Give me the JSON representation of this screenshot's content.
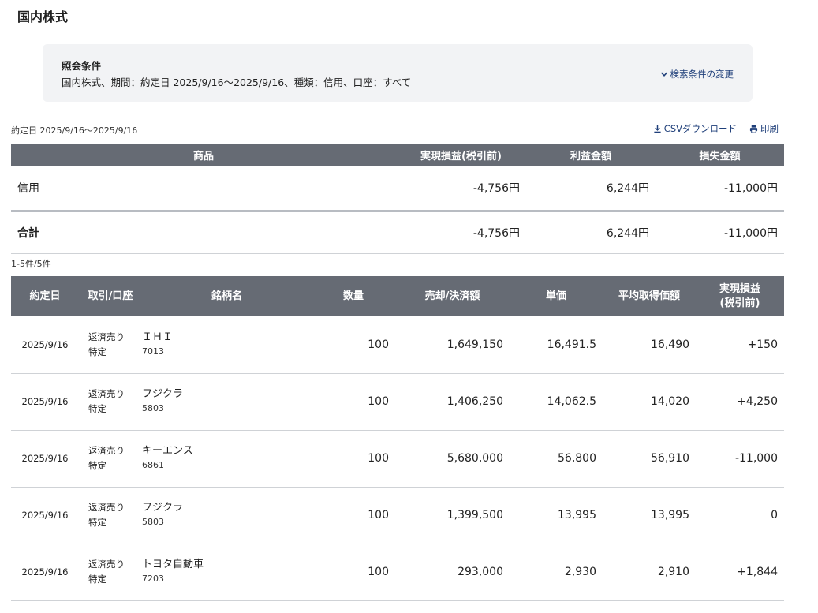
{
  "page_title": "国内株式",
  "conditions": {
    "label": "照会条件",
    "text": "国内株式、期間：約定日 2025/9/16〜2025/9/16、種類：信用、口座：すべて",
    "change_link": "検索条件の変更"
  },
  "range_label": "約定日 2025/9/16〜2025/9/16",
  "tools": {
    "csv": "CSVダウンロード",
    "print": "印刷"
  },
  "summary": {
    "headers": [
      "商品",
      "実現損益(税引前)",
      "利益金額",
      "損失金額"
    ],
    "row": {
      "product": "信用",
      "realized": "-4,756円",
      "profit": "6,244円",
      "loss": "-11,000円"
    },
    "total": {
      "label": "合計",
      "realized": "-4,756円",
      "profit": "6,244円",
      "loss": "-11,000円"
    }
  },
  "count_label": "1-5件/5件",
  "detail": {
    "headers": {
      "date": "約定日",
      "trade": "取引/口座",
      "stock": "銘柄名",
      "qty": "数量",
      "amount": "売却/決済額",
      "price": "単価",
      "avg": "平均取得価額",
      "pl_line1": "実現損益",
      "pl_line2": "(税引前)"
    },
    "rows": [
      {
        "date": "2025/9/16",
        "trade": "返済売り",
        "account": "特定",
        "name": "ＩＨＩ",
        "code": "7013",
        "qty": "100",
        "amount": "1,649,150",
        "price": "16,491.5",
        "avg": "16,490",
        "pl": "+150"
      },
      {
        "date": "2025/9/16",
        "trade": "返済売り",
        "account": "特定",
        "name": "フジクラ",
        "code": "5803",
        "qty": "100",
        "amount": "1,406,250",
        "price": "14,062.5",
        "avg": "14,020",
        "pl": "+4,250"
      },
      {
        "date": "2025/9/16",
        "trade": "返済売り",
        "account": "特定",
        "name": "キーエンス",
        "code": "6861",
        "qty": "100",
        "amount": "5,680,000",
        "price": "56,800",
        "avg": "56,910",
        "pl": "-11,000"
      },
      {
        "date": "2025/9/16",
        "trade": "返済売り",
        "account": "特定",
        "name": "フジクラ",
        "code": "5803",
        "qty": "100",
        "amount": "1,399,500",
        "price": "13,995",
        "avg": "13,995",
        "pl": "0"
      },
      {
        "date": "2025/9/16",
        "trade": "返済売り",
        "account": "特定",
        "name": "トヨタ自動車",
        "code": "7203",
        "qty": "100",
        "amount": "293,000",
        "price": "2,930",
        "avg": "2,910",
        "pl": "+1,844"
      }
    ]
  },
  "colors": {
    "header_bg": "#666b74",
    "negative": "#2f8a8a",
    "positive": "#c72e5f",
    "link": "#1f3f7a"
  }
}
